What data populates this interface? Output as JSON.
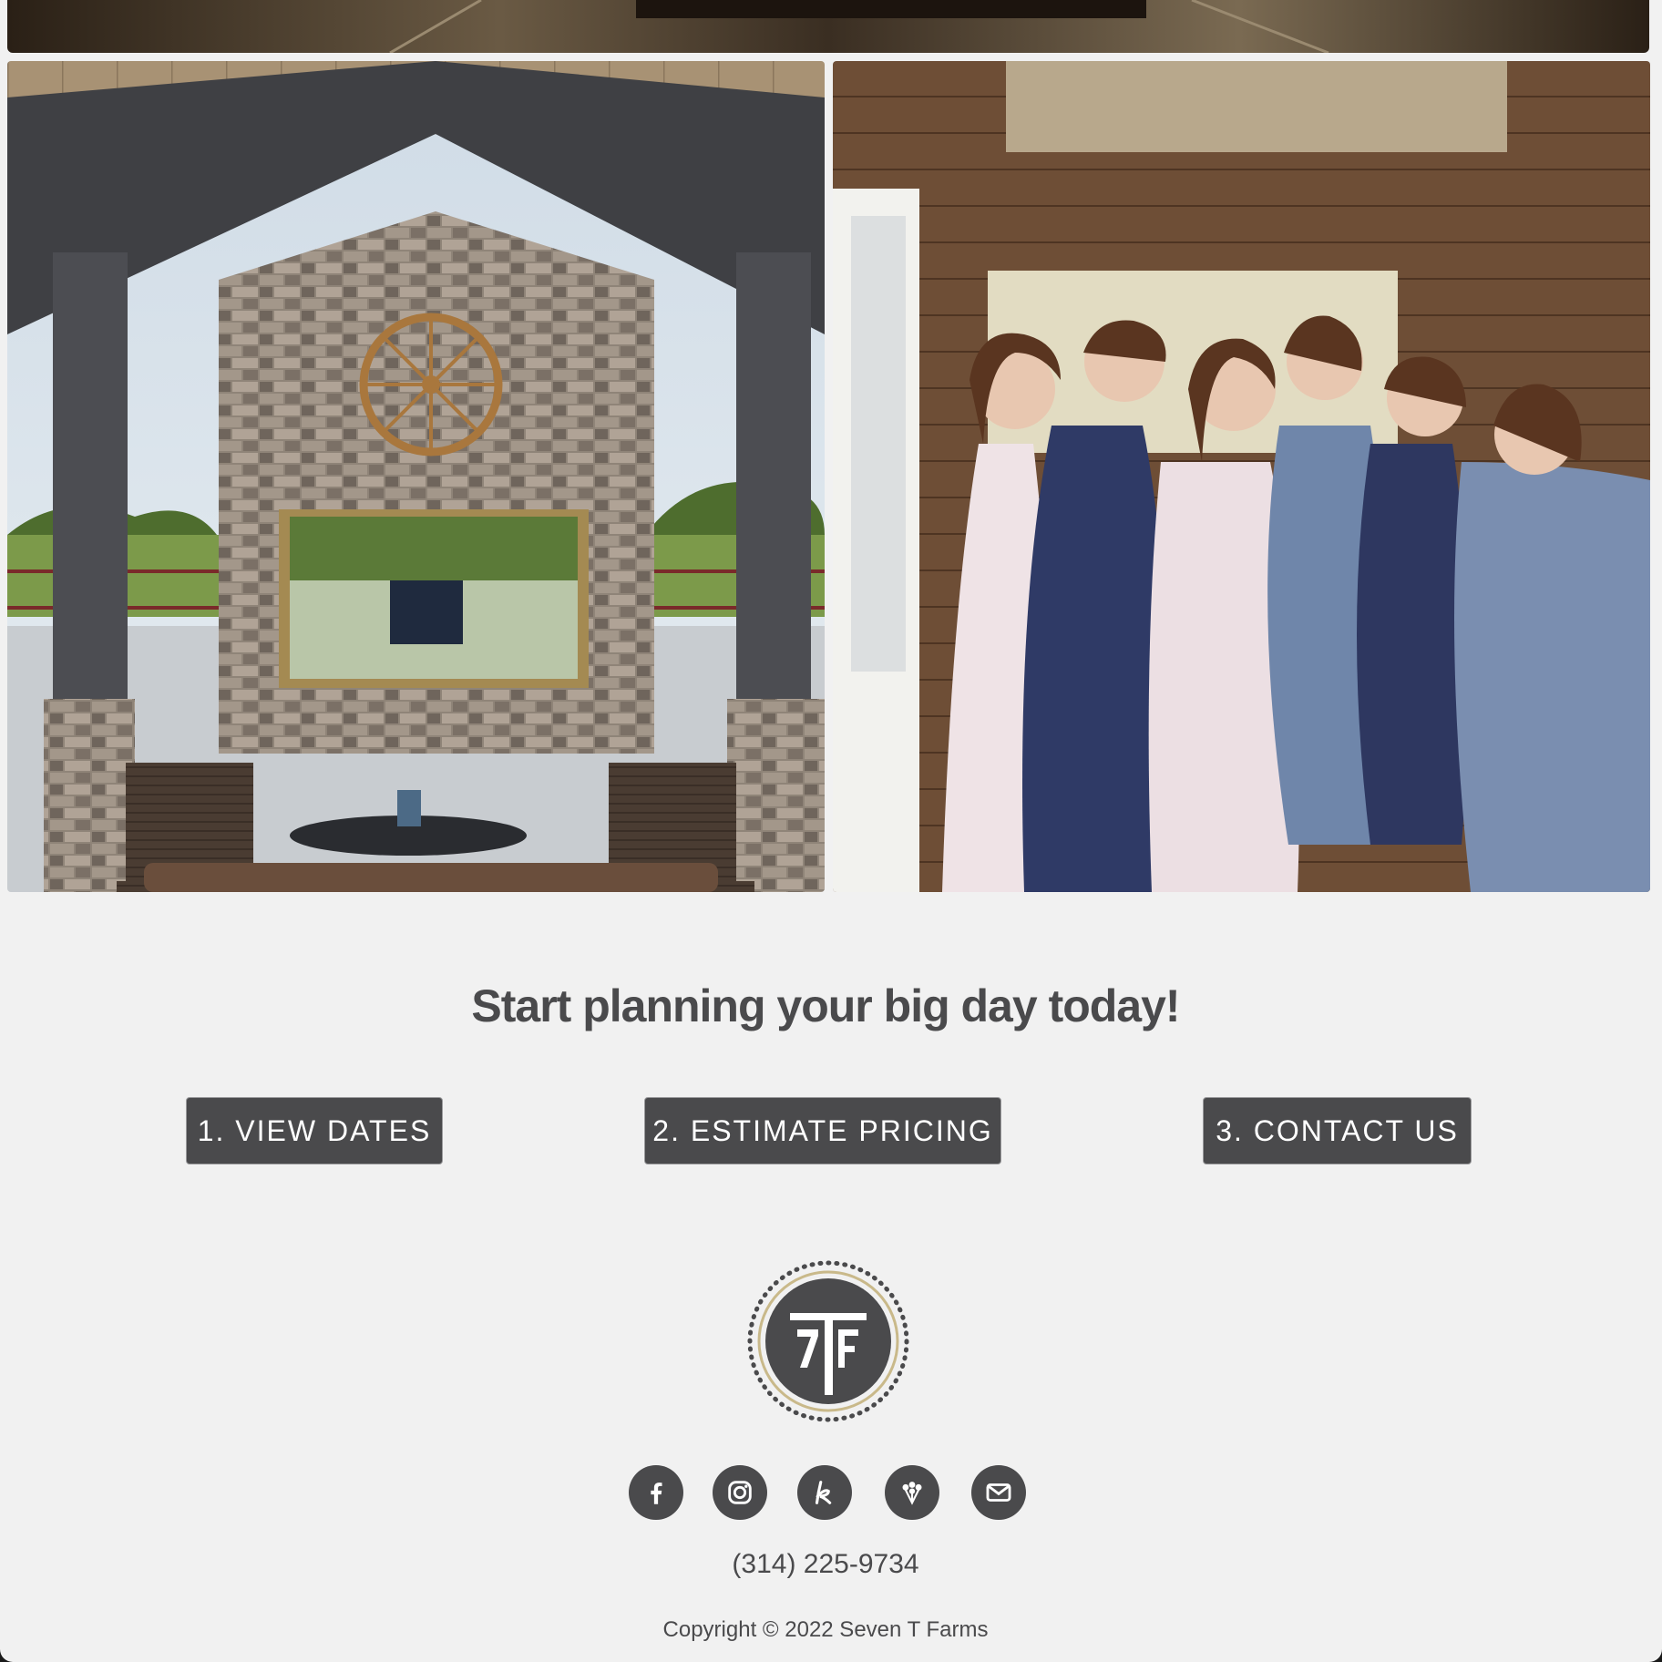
{
  "cta": {
    "heading": "Start planning your big day today!",
    "buttons": [
      {
        "label": "1. VIEW DATES"
      },
      {
        "label": "2. ESTIMATE PRICING"
      },
      {
        "label": "3. CONTACT US"
      }
    ]
  },
  "footer": {
    "logo_text": "7TF",
    "social": [
      {
        "icon": "facebook-icon"
      },
      {
        "icon": "instagram-icon"
      },
      {
        "icon": "the-knot-icon"
      },
      {
        "icon": "wedding-wire-icon"
      },
      {
        "icon": "email-icon"
      }
    ],
    "phone": "(314) 225-9734",
    "copyright": "Copyright © 2022 Seven T Farms"
  },
  "colors": {
    "page_background": "#f1f1f1",
    "button": "#4a4a4c",
    "text": "#4a4a4c",
    "logo_ring": "#c9b98a"
  }
}
